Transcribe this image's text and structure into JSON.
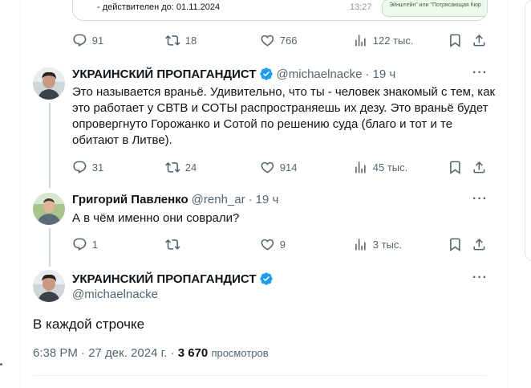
{
  "quoted": {
    "line": "- действителен до: 01.11.2024",
    "time": "13:27",
    "bubble": "Эйнштейн\" или \"Потрясающая Кюр"
  },
  "top_actions": {
    "replies": "91",
    "reposts": "18",
    "likes": "766",
    "views": "122 тыс."
  },
  "tweets": [
    {
      "display_name": "УКРАИНСКИЙ ПРОПАГАНДИСТ",
      "verified": true,
      "handle": "@michaelnacke",
      "sep": "·",
      "time": "19 ч",
      "text_lines": [
        "Это называется враньё. Удивительно, что ты - человек знакомый с тем, как",
        "это работает у СВТВ и СОТЫ распространяешь их дезу. Это враньё будет",
        "опровергнуто Горожанко и Сотой по решению суда (благо и тот и те",
        "обитают в Литве)."
      ],
      "replies": "31",
      "reposts": "24",
      "likes": "914",
      "views": "45 тыс."
    },
    {
      "display_name": "Григорий Павленко",
      "verified": false,
      "handle": "@renh_ar",
      "sep": "·",
      "time": "19 ч",
      "text_lines": [
        "А в чём именно они соврали?"
      ],
      "replies": "1",
      "reposts": "",
      "likes": "9",
      "views": "3 тыс."
    }
  ],
  "main_tweet": {
    "display_name": "УКРАИНСКИЙ ПРОПАГАНДИСТ",
    "handle": "@michaelnacke",
    "text": "В каждой строчке",
    "time": "6:38 PM · 27 дек. 2024 г. ·",
    "views_count": "3 670",
    "views_label": "просмотров"
  },
  "icons": [
    "reply-icon",
    "repost-icon",
    "like-icon",
    "views-icon",
    "bookmark-icon",
    "share-icon",
    "verified-badge-icon",
    "more-icon"
  ],
  "colors": {
    "text": "#0f1419",
    "secondary": "#536471",
    "verified": "#1d9bf0",
    "border": "#eff3f4"
  }
}
